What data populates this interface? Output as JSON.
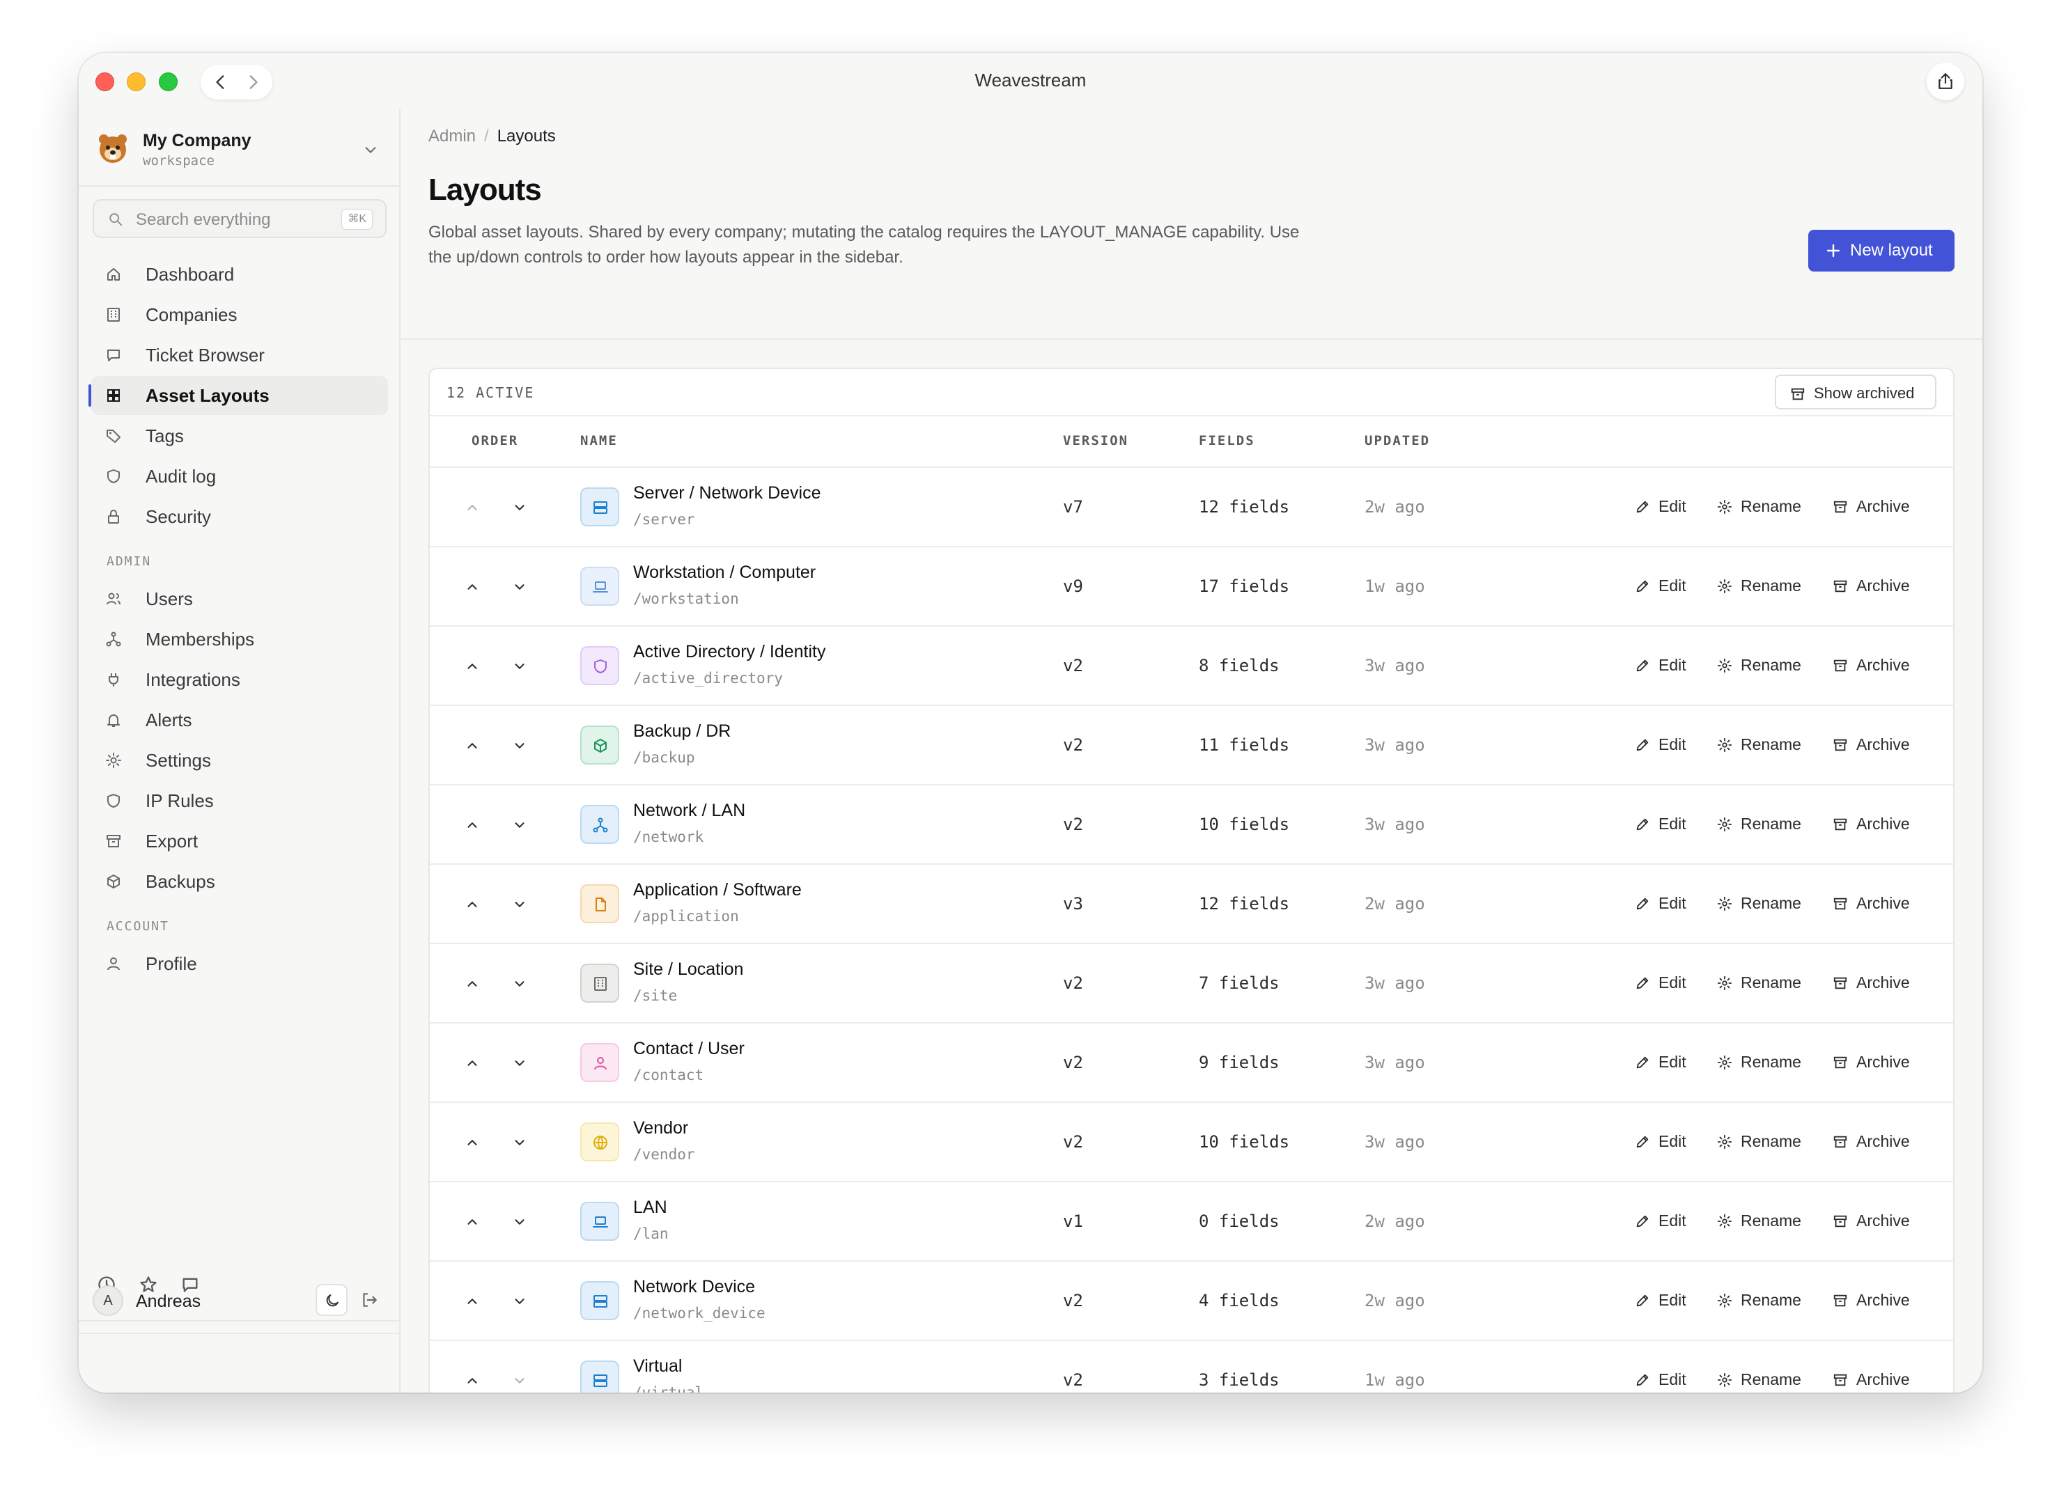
{
  "window": {
    "title": "Weavestream"
  },
  "workspace": {
    "name": "My Company",
    "sub": "workspace"
  },
  "search": {
    "placeholder": "Search everything",
    "shortcut": "⌘K"
  },
  "nav": {
    "main": [
      {
        "label": "Dashboard",
        "icon": "home-icon"
      },
      {
        "label": "Companies",
        "icon": "building-icon"
      },
      {
        "label": "Ticket Browser",
        "icon": "message-icon"
      },
      {
        "label": "Asset Layouts",
        "icon": "grid-icon",
        "active": true
      },
      {
        "label": "Tags",
        "icon": "tag-icon"
      },
      {
        "label": "Audit log",
        "icon": "shield-icon"
      },
      {
        "label": "Security",
        "icon": "lock-icon"
      }
    ],
    "admin_label": "ADMIN",
    "admin": [
      {
        "label": "Users",
        "icon": "users-icon"
      },
      {
        "label": "Memberships",
        "icon": "network-icon"
      },
      {
        "label": "Integrations",
        "icon": "plug-icon"
      },
      {
        "label": "Alerts",
        "icon": "bell-icon"
      },
      {
        "label": "Settings",
        "icon": "gear-icon"
      },
      {
        "label": "IP Rules",
        "icon": "shield-icon"
      },
      {
        "label": "Export",
        "icon": "archive-icon"
      },
      {
        "label": "Backups",
        "icon": "box-icon"
      }
    ],
    "account_label": "ACCOUNT",
    "account": [
      {
        "label": "Profile",
        "icon": "user-icon"
      }
    ]
  },
  "user": {
    "name": "Andreas",
    "initial": "A"
  },
  "breadcrumb": {
    "parent": "Admin",
    "current": "Layouts"
  },
  "page": {
    "title": "Layouts",
    "description": "Global asset layouts. Shared by every company; mutating the catalog requires the LAYOUT_MANAGE capability. Use the up/down controls to order how layouts appear in the sidebar.",
    "new_button": "New layout"
  },
  "table": {
    "count_label": "12 ACTIVE",
    "show_archived": "Show archived",
    "columns": {
      "order": "ORDER",
      "name": "NAME",
      "version": "VERSION",
      "fields": "FIELDS",
      "updated": "UPDATED"
    },
    "actions": {
      "edit": "Edit",
      "rename": "Rename",
      "archive": "Archive"
    },
    "rows": [
      {
        "name": "Server / Network Device",
        "slug": "/server",
        "version": "v7",
        "fields": "12 fields",
        "updated": "2w ago",
        "icon": "server-icon",
        "color": "#1e7fcf",
        "bg": "#e3f0fb"
      },
      {
        "name": "Workstation / Computer",
        "slug": "/workstation",
        "version": "v9",
        "fields": "17 fields",
        "updated": "1w ago",
        "icon": "laptop-icon",
        "color": "#5a8fd8",
        "bg": "#e9f1fc"
      },
      {
        "name": "Active Directory / Identity",
        "slug": "/active_directory",
        "version": "v2",
        "fields": "8 fields",
        "updated": "3w ago",
        "icon": "shield-icon",
        "color": "#a25fe0",
        "bg": "#f3e9fc"
      },
      {
        "name": "Backup / DR",
        "slug": "/backup",
        "version": "v2",
        "fields": "11 fields",
        "updated": "3w ago",
        "icon": "box-icon",
        "color": "#17955a",
        "bg": "#e1f4ea"
      },
      {
        "name": "Network / LAN",
        "slug": "/network",
        "version": "v2",
        "fields": "10 fields",
        "updated": "3w ago",
        "icon": "network-icon",
        "color": "#1e7fcf",
        "bg": "#e3f0fb"
      },
      {
        "name": "Application / Software",
        "slug": "/application",
        "version": "v3",
        "fields": "12 fields",
        "updated": "2w ago",
        "icon": "file-icon",
        "color": "#d9800f",
        "bg": "#fcefdc"
      },
      {
        "name": "Site / Location",
        "slug": "/site",
        "version": "v2",
        "fields": "7 fields",
        "updated": "3w ago",
        "icon": "building-icon",
        "color": "#6b6b6b",
        "bg": "#ededec"
      },
      {
        "name": "Contact / User",
        "slug": "/contact",
        "version": "v2",
        "fields": "9 fields",
        "updated": "3w ago",
        "icon": "user-icon",
        "color": "#e0529f",
        "bg": "#fce8f2"
      },
      {
        "name": "Vendor",
        "slug": "/vendor",
        "version": "v2",
        "fields": "10 fields",
        "updated": "3w ago",
        "icon": "globe-icon",
        "color": "#e0b00f",
        "bg": "#fdf5d8"
      },
      {
        "name": "LAN",
        "slug": "/lan",
        "version": "v1",
        "fields": "0 fields",
        "updated": "2w ago",
        "icon": "laptop-icon",
        "color": "#1e7fcf",
        "bg": "#e3f0fb"
      },
      {
        "name": "Network Device",
        "slug": "/network_device",
        "version": "v2",
        "fields": "4 fields",
        "updated": "2w ago",
        "icon": "server-icon",
        "color": "#1e7fcf",
        "bg": "#e3f0fb"
      },
      {
        "name": "Virtual",
        "slug": "/virtual",
        "version": "v2",
        "fields": "3 fields",
        "updated": "1w ago",
        "icon": "server-icon",
        "color": "#1e7fcf",
        "bg": "#e3f0fb"
      }
    ]
  },
  "colors": {
    "accent": "#4353d7"
  }
}
